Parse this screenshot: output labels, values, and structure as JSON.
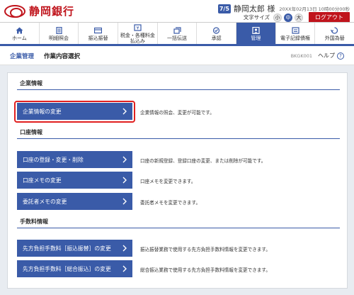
{
  "header": {
    "bank_name": "静岡銀行",
    "user_badge": "7/5",
    "user_name": "静岡太郎 様",
    "datetime": "20XX年02月13日 10時00分00秒",
    "font_size_label": "文字サイズ",
    "font_sizes": [
      "小",
      "中",
      "大"
    ],
    "font_size_selected": "中",
    "logout_label": "ログアウト"
  },
  "nav": {
    "items": [
      {
        "label": "ホーム",
        "icon": "home-icon"
      },
      {
        "label": "明細照会",
        "icon": "document-icon"
      },
      {
        "label": "振込振替",
        "icon": "transfer-icon"
      },
      {
        "label": "税金・各種料金払込み",
        "icon": "payment-icon"
      },
      {
        "label": "一括伝送",
        "icon": "batch-icon"
      },
      {
        "label": "承認",
        "icon": "approval-icon"
      },
      {
        "label": "管理",
        "icon": "admin-icon"
      },
      {
        "label": "電子記録債権",
        "icon": "ereceivable-icon"
      },
      {
        "label": "外国為替",
        "icon": "forex-icon"
      }
    ],
    "active": "管理"
  },
  "page_header": {
    "section": "企業管理",
    "title": "作業内容選択",
    "screen_code": "BKGK001",
    "help_label": "ヘルプ"
  },
  "sections": [
    {
      "title": "企業情報",
      "items": [
        {
          "label": "企業情報の変更",
          "desc": "企業情報の照会、変更が可能です。"
        }
      ]
    },
    {
      "title": "口座情報",
      "items": [
        {
          "label": "口座の登録・変更・削除",
          "desc": "口座の新規登録、登録口座の変更、または削除が可能です。"
        },
        {
          "label": "口座メモの変更",
          "desc": "口座メモを変更できます。"
        },
        {
          "label": "委託者メモの変更",
          "desc": "委託者メモを変更できます。"
        }
      ]
    },
    {
      "title": "手数料情報",
      "items": [
        {
          "label": "先方負担手数料［振込振替］の変更",
          "desc": "振込振替業務で使用する先方負担手数料情報を変更できます。"
        },
        {
          "label": "先方負担手数料［総合振込］の変更",
          "desc": "総合振込業務で使用する先方負担手数料情報を変更できます。"
        }
      ]
    }
  ],
  "colors": {
    "brand_red": "#c0141c",
    "primary_blue": "#3a5ba8",
    "highlight_red": "#e02020",
    "background": "#e8ecf1"
  }
}
